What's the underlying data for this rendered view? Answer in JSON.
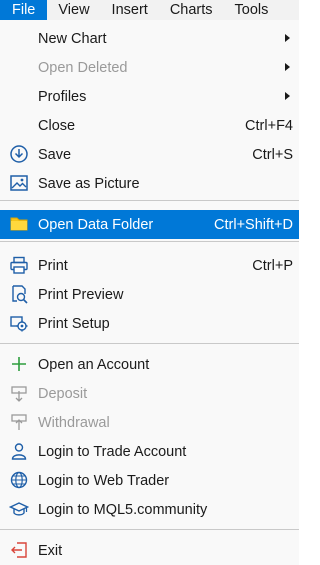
{
  "menubar": {
    "items": [
      "File",
      "View",
      "Insert",
      "Charts",
      "Tools"
    ]
  },
  "menu": {
    "new_chart": {
      "label": "New Chart"
    },
    "open_deleted": {
      "label": "Open Deleted"
    },
    "profiles": {
      "label": "Profiles"
    },
    "close": {
      "label": "Close",
      "shortcut": "Ctrl+F4"
    },
    "save": {
      "label": "Save",
      "shortcut": "Ctrl+S",
      "icon": "save-download-icon"
    },
    "save_picture": {
      "label": "Save as Picture",
      "icon": "picture-icon"
    },
    "open_data_folder": {
      "label": "Open Data Folder",
      "shortcut": "Ctrl+Shift+D",
      "icon": "folder-icon"
    },
    "print": {
      "label": "Print",
      "shortcut": "Ctrl+P",
      "icon": "printer-icon"
    },
    "print_preview": {
      "label": "Print Preview",
      "icon": "print-preview-icon"
    },
    "print_setup": {
      "label": "Print Setup",
      "icon": "print-setup-icon"
    },
    "open_account": {
      "label": "Open an Account",
      "icon": "plus-icon"
    },
    "deposit": {
      "label": "Deposit",
      "icon": "deposit-icon"
    },
    "withdrawal": {
      "label": "Withdrawal",
      "icon": "withdrawal-icon"
    },
    "login_trade": {
      "label": "Login to Trade Account",
      "icon": "user-icon"
    },
    "login_web": {
      "label": "Login to Web Trader",
      "icon": "globe-icon"
    },
    "login_mql5": {
      "label": "Login to MQL5.community",
      "icon": "graduation-cap-icon"
    },
    "exit": {
      "label": "Exit",
      "icon": "exit-icon"
    }
  },
  "colors": {
    "accent": "#0078d7",
    "icon_blue": "#1f5fa8",
    "folder": "#f5c518",
    "plus_green": "#2e9e3e",
    "exit_red": "#d9453a",
    "disabled": "#9a9a9a"
  }
}
